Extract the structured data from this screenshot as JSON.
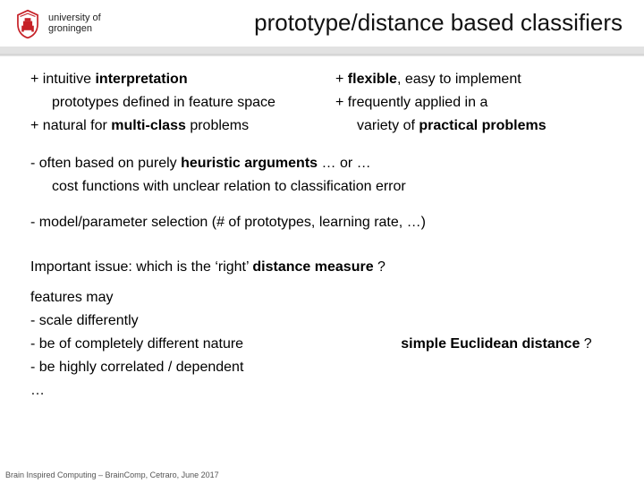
{
  "logo": {
    "university": "university of",
    "name": "groningen"
  },
  "title": "prototype/distance based classifiers",
  "pros": {
    "left": {
      "p1_pre": "+  intuitive ",
      "p1_b": "interpretation",
      "sub1": "prototypes defined in feature space",
      "p2_pre": "+  natural for ",
      "p2_b": "multi-class",
      "p2_post": " problems"
    },
    "right": {
      "p1_pre": "+ ",
      "p1_b": "flexible",
      "p1_post": ", easy to implement",
      "p2_pre": "+  frequently applied in a",
      "p2_sub": "variety of ",
      "p2_b": "practical problems"
    }
  },
  "cons": {
    "l1_pre": "-  often based on purely ",
    "l1_b": "heuristic arguments",
    "l1_post": "  … or …",
    "l1_sub": "cost functions with unclear relation to classification error",
    "l2": "-  model/parameter selection    (# of prototypes, learning rate, …)"
  },
  "issue": {
    "line_pre": "Important issue: which is the ‘right’ ",
    "line_b": "distance measure",
    "line_q": " ?",
    "features_title": "features may",
    "f1": "- scale differently",
    "f2": "- be of completely different nature",
    "f3": "- be highly correlated / dependent",
    "f4": "  …",
    "euclid_b": "simple Euclidean distance",
    "euclid_q": " ?"
  },
  "footer": "Brain Inspired Computing – BrainComp, Cetraro, June 2017"
}
